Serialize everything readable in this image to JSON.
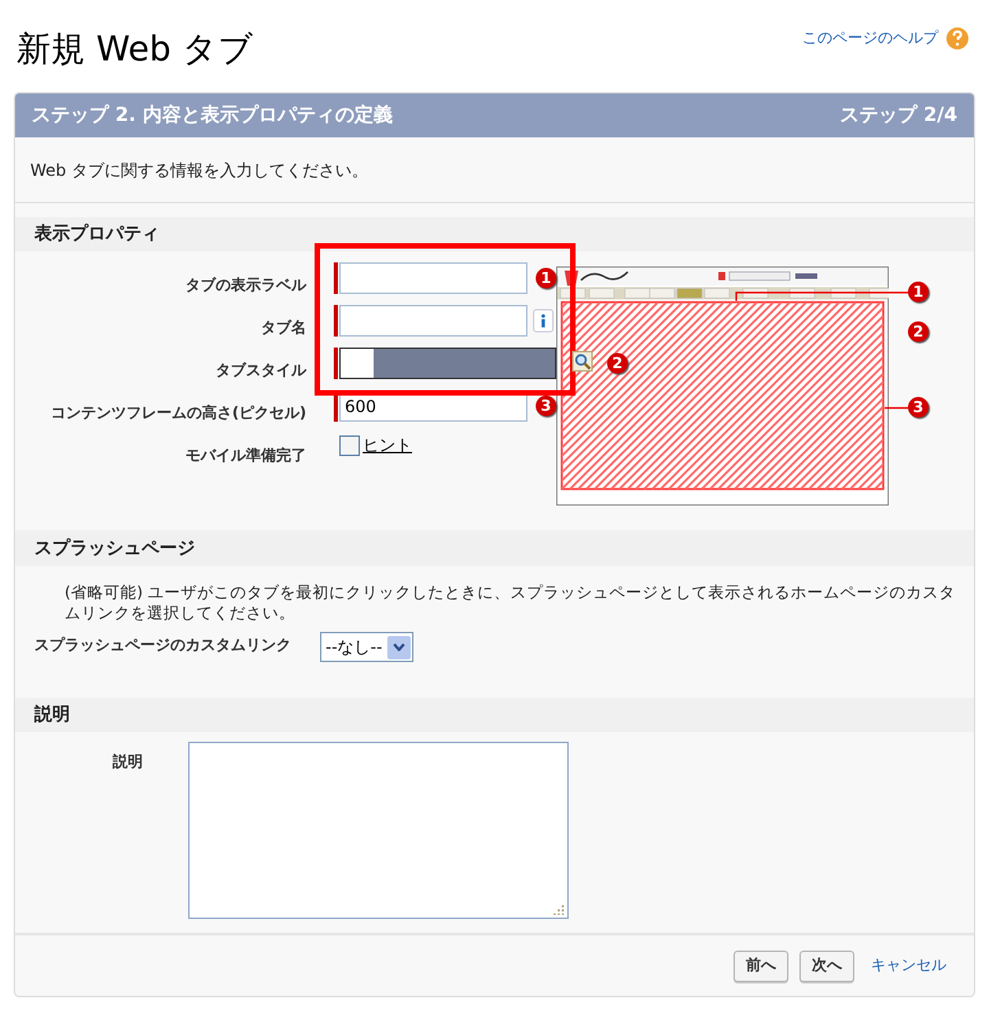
{
  "page": {
    "title": "新規 Web タブ",
    "help_link": "このページのヘルプ"
  },
  "step_bar": {
    "title": "ステップ 2. 内容と表示プロパティの定義",
    "counter": "ステップ 2/4"
  },
  "intro": "Web タブに関する情報を入力してください。",
  "display_section": {
    "heading": "表示プロパティ",
    "fields": [
      {
        "label": "タブの表示ラベル",
        "kind": "text",
        "required": true,
        "callout": "1"
      },
      {
        "label": "タブ名",
        "kind": "text",
        "required": true,
        "info": true
      },
      {
        "label": "タブスタイル",
        "kind": "style",
        "required": true,
        "callout": "2"
      },
      {
        "label": "コンテンツフレームの高さ(ピクセル)",
        "kind": "text",
        "required": true,
        "value": "600",
        "callout": "3"
      },
      {
        "label": "モバイル準備完了",
        "kind": "checkbox",
        "required": false,
        "checked": false,
        "link": "ヒント"
      }
    ],
    "preview_callouts": [
      "1",
      "2",
      "3"
    ]
  },
  "splash_section": {
    "heading": "スプラッシュページ",
    "description": "(省略可能) ユーザがこのタブを最初にクリックしたときに、スプラッシュページとして表示されるホームページのカスタムリンクを選択してください。",
    "label": "スプラッシュページのカスタムリンク",
    "select_value": "--なし--"
  },
  "description_section": {
    "heading": "説明",
    "label": "説明"
  },
  "footer": {
    "buttons": [
      "前へ",
      "次へ"
    ],
    "cancel": "キャンセル"
  }
}
